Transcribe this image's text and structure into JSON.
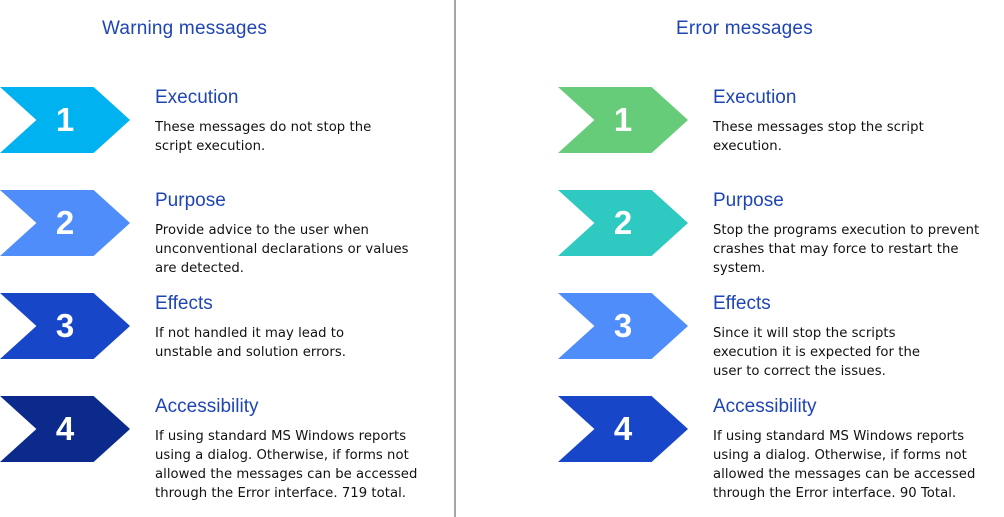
{
  "columns": [
    {
      "title": "Warning messages",
      "items": [
        {
          "number": "1",
          "color": "#00b2f0",
          "heading": "Execution",
          "lines": [
            "These messages do not stop the",
            "script execution."
          ]
        },
        {
          "number": "2",
          "color": "#4f8dfa",
          "heading": "Purpose",
          "lines": [
            "Provide advice to the user when",
            "unconventional declarations or values",
            "are detected."
          ]
        },
        {
          "number": "3",
          "color": "#1746c9",
          "heading": "Effects",
          "lines": [
            "If not handled it may lead to",
            "unstable and solution errors."
          ]
        },
        {
          "number": "4",
          "color": "#0b2a8b",
          "heading": "Accessibility",
          "lines": [
            "If using standard MS Windows reports",
            "using a dialog. Otherwise, if forms not",
            "allowed the messages can be accessed",
            "through the Error interface. 719 total."
          ]
        }
      ]
    },
    {
      "title": "Error messages",
      "items": [
        {
          "number": "1",
          "color": "#66cc7a",
          "heading": "Execution",
          "lines": [
            "These messages stop the script",
            "execution."
          ]
        },
        {
          "number": "2",
          "color": "#2ec9c0",
          "heading": "Purpose",
          "lines": [
            "Stop the programs execution to prevent",
            "crashes that may force to restart the",
            "system."
          ]
        },
        {
          "number": "3",
          "color": "#4f8dfa",
          "heading": "Effects",
          "lines": [
            "Since it will stop the scripts",
            "execution it is expected for the",
            "user to correct the issues."
          ]
        },
        {
          "number": "4",
          "color": "#1746c9",
          "heading": "Accessibility",
          "lines": [
            "If using standard MS Windows reports",
            "using a dialog. Otherwise, if forms not",
            "allowed the messages can be accessed",
            "through the Error interface. 90 Total."
          ]
        }
      ]
    }
  ]
}
